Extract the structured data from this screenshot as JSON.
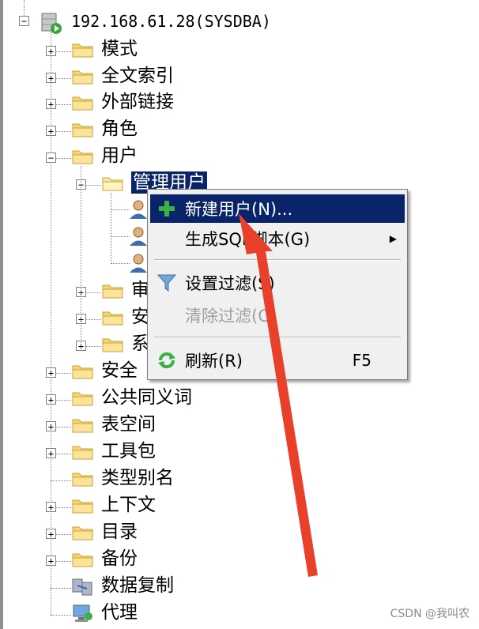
{
  "tree": {
    "server_label": "192.168.61.28(SYSDBA)",
    "nodes": [
      {
        "label": "模式",
        "toggle": "+"
      },
      {
        "label": "全文索引",
        "toggle": "+"
      },
      {
        "label": "外部链接",
        "toggle": "+"
      },
      {
        "label": "角色",
        "toggle": "+"
      },
      {
        "label": "用户",
        "toggle": "-"
      },
      {
        "label": "管理用户",
        "toggle": "-"
      },
      {
        "label": "审",
        "toggle": "+"
      },
      {
        "label": "安",
        "toggle": "+"
      },
      {
        "label": "系",
        "toggle": "+"
      },
      {
        "label": "安全",
        "toggle": "+"
      },
      {
        "label": "公共同义词",
        "toggle": "+"
      },
      {
        "label": "表空间",
        "toggle": "+"
      },
      {
        "label": "工具包",
        "toggle": "+"
      },
      {
        "label": "类型别名",
        "toggle": ""
      },
      {
        "label": "上下文",
        "toggle": "+"
      },
      {
        "label": "目录",
        "toggle": "+"
      },
      {
        "label": "备份",
        "toggle": "+"
      },
      {
        "label": "数据复制",
        "toggle": ""
      },
      {
        "label": "代理",
        "toggle": ""
      }
    ]
  },
  "context_menu": {
    "items": [
      {
        "label": "新建用户(N)...",
        "shortcut": ""
      },
      {
        "label": "生成SQL脚本(G)",
        "shortcut": ""
      },
      {
        "label": "设置过滤(S)",
        "shortcut": ""
      },
      {
        "label": "清除过滤(C)",
        "shortcut": ""
      },
      {
        "label": "刷新(R)",
        "shortcut": "F5"
      }
    ]
  },
  "watermark": "CSDN @我叫农",
  "colors": {
    "selection": "#0a246a",
    "folder": "#f5d76e",
    "annotation_arrow": "#e8402a"
  }
}
